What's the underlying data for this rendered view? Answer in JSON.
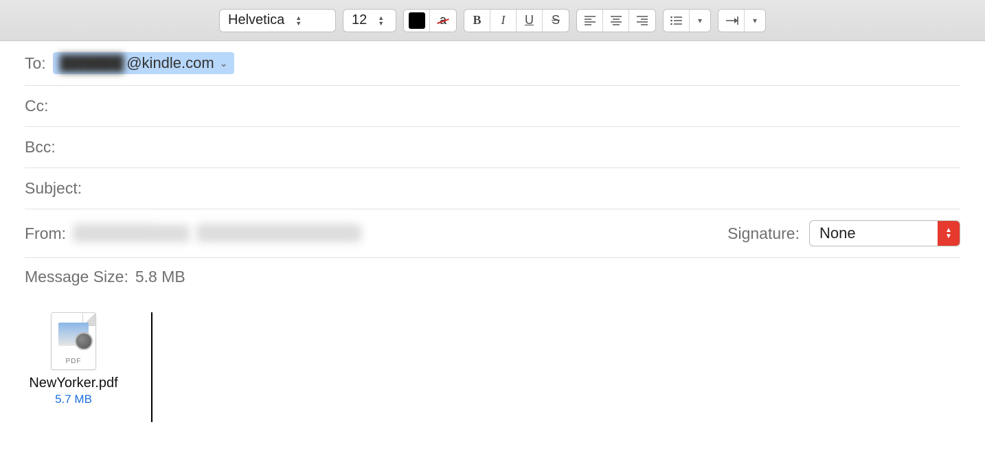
{
  "toolbar": {
    "font_family": "Helvetica",
    "font_size": "12",
    "text_color": "#000000",
    "highlight_none_glyph": "a",
    "bold_label": "B",
    "italic_label": "I",
    "underline_label": "U",
    "strike_label": "S",
    "list_icon": "list",
    "indent_icon": "indent"
  },
  "fields": {
    "to_label": "To:",
    "to_recipient_hidden": "██████",
    "to_recipient_visible": "@kindle.com",
    "cc_label": "Cc:",
    "cc_value": "",
    "bcc_label": "Bcc:",
    "bcc_value": "",
    "subject_label": "Subject:",
    "subject_value": "",
    "from_label": "From:",
    "from_name_hidden": "██████████",
    "from_email_hidden": "████████████████████",
    "signature_label": "Signature:",
    "signature_value": "None",
    "message_size_label": "Message Size:",
    "message_size_value": "5.8 MB"
  },
  "attachment": {
    "filename": "NewYorker.pdf",
    "filesize": "5.7 MB",
    "type_label": "PDF"
  }
}
